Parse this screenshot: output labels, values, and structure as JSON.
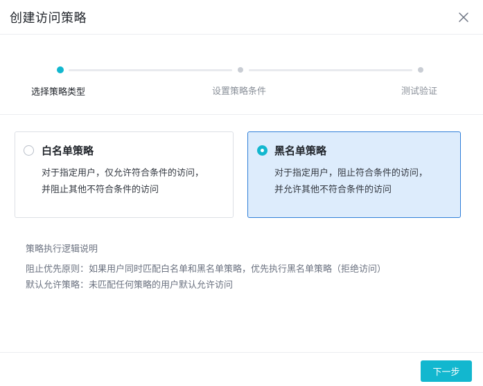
{
  "dialog": {
    "title": "创建访问策略",
    "close_icon": "close-icon"
  },
  "steps": [
    {
      "label": "选择策略类型",
      "state": "active"
    },
    {
      "label": "设置策略条件",
      "state": "inactive"
    },
    {
      "label": "测试验证",
      "state": "inactive"
    }
  ],
  "options": [
    {
      "title": "白名单策略",
      "desc_line1": "对于指定用户，仅允许符合条件的访问，",
      "desc_line2": "并阻止其他不符合条件的访问",
      "selected": false
    },
    {
      "title": "黑名单策略",
      "desc_line1": "对于指定用户，阻止符合条件的访问，",
      "desc_line2": "并允许其他不符合条件的访问",
      "selected": true
    }
  ],
  "info": {
    "title": "策略执行逻辑说明",
    "line1": "阻止优先原则：如果用户同时匹配白名单和黑名单策略，优先执行黑名单策略（拒绝访问）",
    "line2": "默认允许策略：未匹配任何策略的用户默认允许访问"
  },
  "footer": {
    "next_label": "下一步"
  },
  "colors": {
    "accent": "#12b7cf",
    "selected_bg": "#ddecfc",
    "selected_border": "#2f7ed8"
  }
}
